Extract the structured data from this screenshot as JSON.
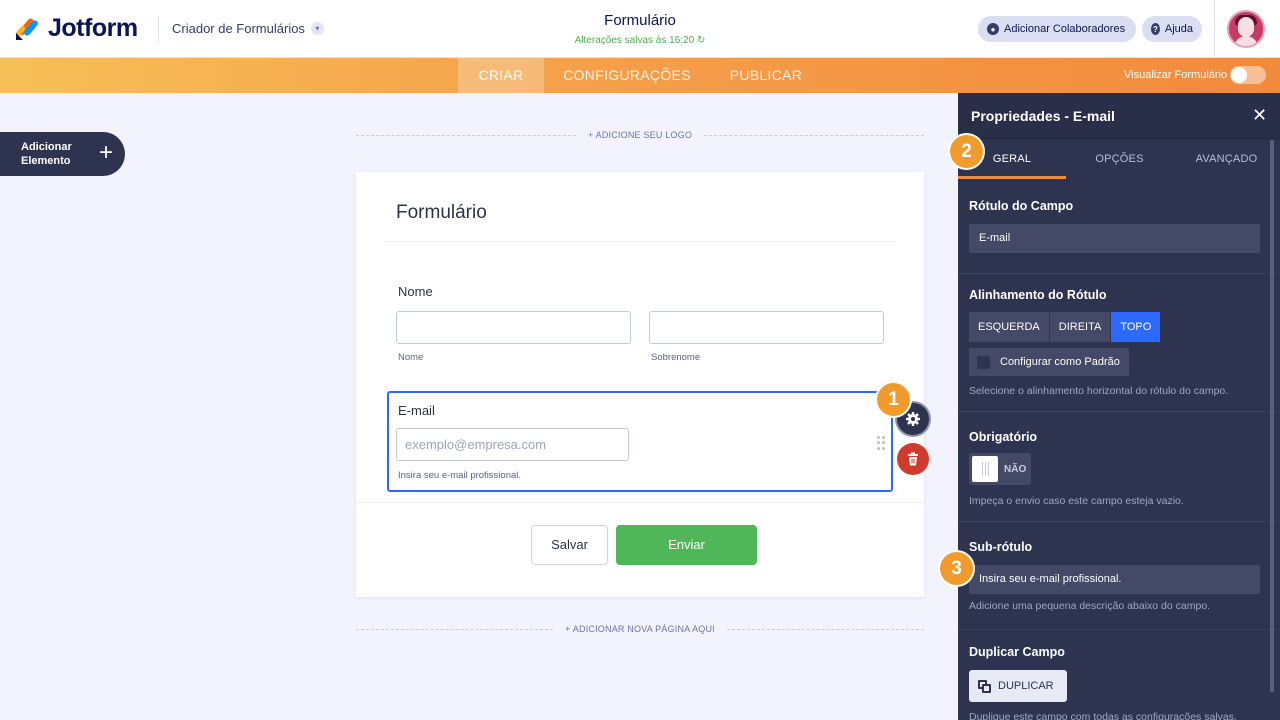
{
  "header": {
    "logo_text": "Jotform",
    "builder_label": "Criador de Formulários",
    "form_title": "Formulário",
    "saved_status": "Alterações salvas às 16:20",
    "add_collaborators": "Adicionar Colaboradores",
    "help": "Ajuda",
    "colors": {
      "logo_blue": "#0099ff",
      "logo_orange": "#ff6100",
      "logo_yellow": "#ffb629",
      "logo_navy": "#0a1551"
    }
  },
  "nav": {
    "tabs": [
      {
        "label": "CRIAR",
        "active": true
      },
      {
        "label": "CONFIGURAÇÕES",
        "active": false
      },
      {
        "label": "PUBLICAR",
        "active": false
      }
    ],
    "preview_label": "Visualizar Formulário",
    "preview_on": false
  },
  "sidebar": {
    "add_element": "Adicionar Elemento",
    "add_icon": "plus-icon"
  },
  "canvas": {
    "add_logo": "+ ADICIONE SEU LOGO",
    "add_page": "+ ADICIONAR NOVA PÁGINA AQUI",
    "form": {
      "title": "Formulário",
      "name_field": {
        "label": "Nome",
        "first_sublabel": "Nome",
        "last_sublabel": "Sobrenome"
      },
      "email_field": {
        "label": "E-mail",
        "placeholder": "exemplo@empresa.com",
        "sublabel": "Insira seu e-mail profissional."
      },
      "save_button": "Salvar",
      "submit_button": "Enviar"
    },
    "badges": [
      "1",
      "2",
      "3"
    ]
  },
  "panel": {
    "title": "Propriedades - E-mail",
    "tabs": [
      {
        "label": "GERAL",
        "active": true
      },
      {
        "label": "OPÇÕES",
        "active": false
      },
      {
        "label": "AVANÇADO",
        "active": false
      }
    ],
    "field_label": {
      "heading": "Rótulo do Campo",
      "value": "E-mail"
    },
    "alignment": {
      "heading": "Alinhamento do Rótulo",
      "options": [
        "ESQUERDA",
        "DIREITA",
        "TOPO"
      ],
      "selected": "TOPO",
      "default_label": "Configurar como Padrão",
      "description": "Selecione o alinhamento horizontal do rótulo do campo."
    },
    "required": {
      "heading": "Obrigatório",
      "state_label": "NÃO",
      "description": "Impeça o envio caso este campo esteja vazio."
    },
    "sublabel": {
      "heading": "Sub-rótulo",
      "value": "Insira seu e-mail profissional.",
      "description": "Adicione uma pequena descrição abaixo do campo."
    },
    "duplicate": {
      "heading": "Duplicar Campo",
      "button": "DUPLICAR",
      "description": "Duplique este campo com todas as configurações salvas."
    }
  }
}
